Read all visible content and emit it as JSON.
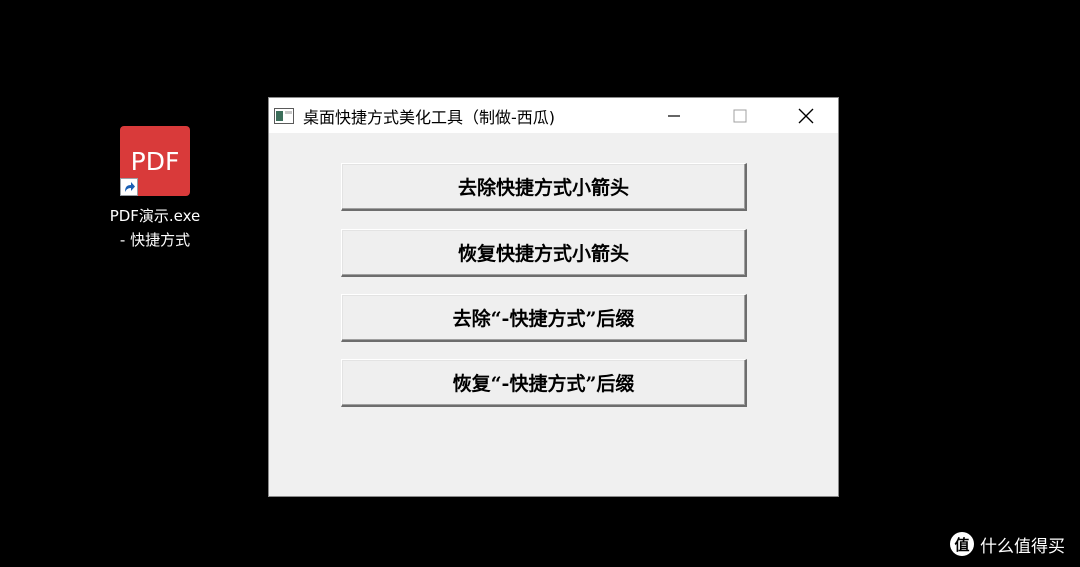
{
  "desktop": {
    "shortcut": {
      "icon_text": "PDF",
      "icon_color": "#d93a3a",
      "label_line1": "PDF演示.exe",
      "label_line2": "- 快捷方式"
    }
  },
  "window": {
    "title": "桌面快捷方式美化工具（制做-西瓜)",
    "controls": {
      "minimize": "minimize-icon",
      "maximize": "maximize-icon",
      "close": "close-icon"
    },
    "buttons": [
      {
        "label": "去除快捷方式小箭头"
      },
      {
        "label": "恢复快捷方式小箭头"
      },
      {
        "label": "去除“-快捷方式”后缀"
      },
      {
        "label": "恢复“-快捷方式”后缀"
      }
    ]
  },
  "watermark": {
    "logo": "值",
    "text": "什么值得买"
  }
}
